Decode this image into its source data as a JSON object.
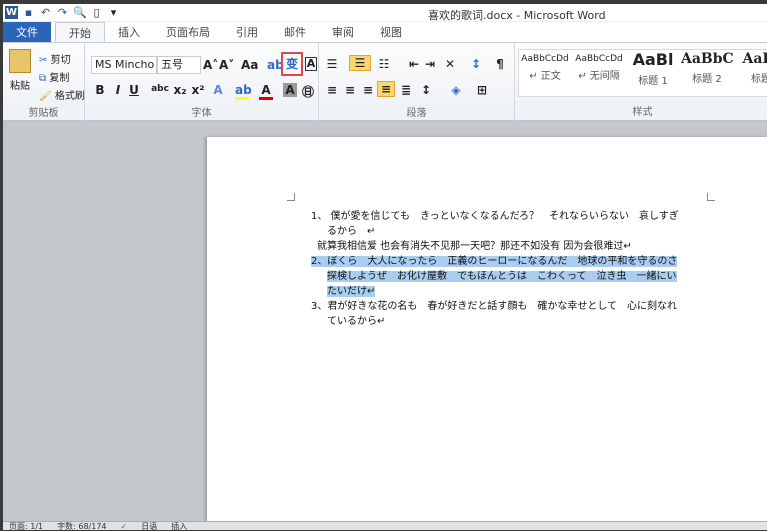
{
  "window": {
    "title": "喜欢的歌词.docx - Microsoft Word"
  },
  "qat": {
    "icons": [
      "word-icon",
      "save-icon",
      "undo-icon",
      "redo-icon",
      "print-preview-icon",
      "new-doc-icon",
      "customize-icon"
    ]
  },
  "tabs": [
    {
      "label": "文件"
    },
    {
      "label": "开始"
    },
    {
      "label": "插入"
    },
    {
      "label": "页面布局"
    },
    {
      "label": "引用"
    },
    {
      "label": "邮件"
    },
    {
      "label": "审阅"
    },
    {
      "label": "视图"
    }
  ],
  "clipboard": {
    "paste": "粘贴",
    "cut": "剪切",
    "copy": "复制",
    "format_painter": "格式刷",
    "label": "剪贴板"
  },
  "font": {
    "name": "MS Mincho",
    "size": "五号",
    "label": "字体",
    "phonetic_guide_highlighted": true
  },
  "paragraph": {
    "label": "段落"
  },
  "styles": {
    "label": "样式",
    "items": [
      {
        "preview": "AaBbCcDd",
        "name": "↵ 正文"
      },
      {
        "preview": "AaBbCcDd",
        "name": "↵ 无间隔"
      },
      {
        "preview": "AaBl",
        "name": "标题 1"
      },
      {
        "preview": "AaBbC",
        "name": "标题 2"
      },
      {
        "preview": "AaBl",
        "name": "标题"
      }
    ]
  },
  "document": {
    "lines": [
      {
        "text": "1、 僕が愛を信じても　きっといなくなるんだろ？　それならいらない　哀しすぎ",
        "selected": false,
        "indent": 0
      },
      {
        "text": "るから　↵",
        "selected": false,
        "indent": 2
      },
      {
        "text": "就算我相信爱 也会有消失不见那一天吧？那还不如没有 因为会很难过↵",
        "selected": false,
        "indent": 1
      },
      {
        "text": "2、ぼくら　大人になったら　正義のヒーローになるんだ　地球の平和を守るのさ",
        "selected": true,
        "indent": 0
      },
      {
        "text": "探検しようぜ　お化け屋敷　でもほんとうは　こわくって　泣き虫　一緒にい",
        "selected": true,
        "indent": 2
      },
      {
        "text": "たいだけ↵",
        "selected": true,
        "indent": 2
      },
      {
        "text": "3、君が好きな花の名も　春が好きだと話す顔も　確かな幸せとして　心に刻なれ",
        "selected": false,
        "indent": 0
      },
      {
        "text": "ているから↵",
        "selected": false,
        "indent": 2
      }
    ]
  },
  "status": {
    "page": "页面: 1/1",
    "words": "字数: 68/174",
    "language": "日语",
    "mode": "插入"
  },
  "colors": {
    "file_tab": "#2a65b8",
    "selection": "#a9cdf0",
    "highlight_box": "#e04848"
  }
}
